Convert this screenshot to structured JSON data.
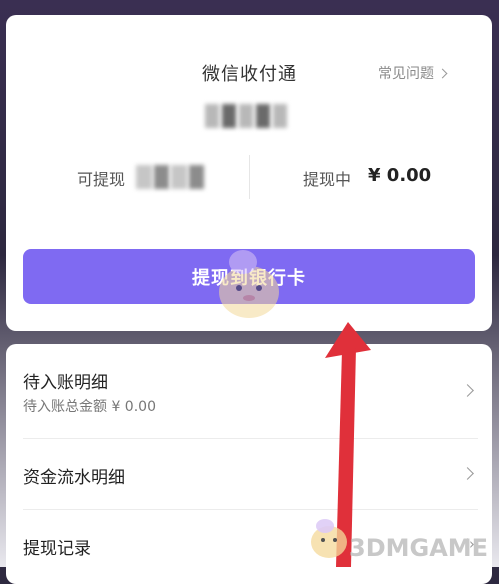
{
  "wallet": {
    "title": "微信收付通",
    "faq_label": "常见问题"
  },
  "balances": {
    "available_label": "可提现",
    "pending_label": "提现中",
    "pending_amount": "¥ 0.00"
  },
  "actions": {
    "withdraw_button": "提现到银行卡"
  },
  "menu": {
    "items": [
      {
        "title": "待入账明细",
        "subtitle": "待入账总金额 ¥ 0.00"
      },
      {
        "title": "资金流水明细"
      },
      {
        "title": "提现记录"
      }
    ]
  },
  "watermark": {
    "text": "3DMGAME"
  },
  "colors": {
    "accent": "#7f6af2",
    "annotation_arrow": "#e0303a"
  },
  "icons": {
    "faq_chevron": "chevron-right-icon",
    "row_chevron": "chevron-right-icon",
    "mascot": "mascot-watermark-icon",
    "annotation": "red-arrow-up-icon"
  }
}
